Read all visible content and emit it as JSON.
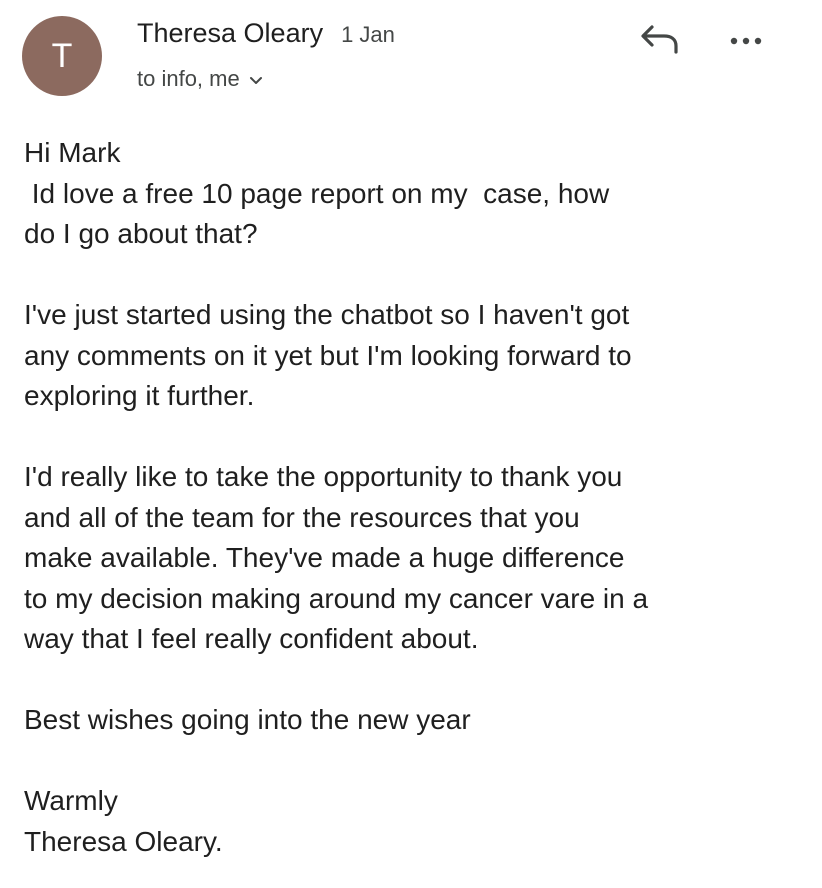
{
  "email": {
    "avatar_letter": "T",
    "avatar_color": "#8c6a5f",
    "sender_name": "Theresa Oleary",
    "date": "1 Jan",
    "recipients": "to info, me",
    "icons": {
      "reply": "reply-icon",
      "more": "more-options-icon",
      "expand": "chevron-down-icon"
    },
    "body": {
      "greeting": "Hi Mark",
      "line1": " Id love a free 10 page report on my  case, how",
      "line2": "do I go about that?",
      "line3": "I've just started using the chatbot so I haven't got",
      "line4": "any comments on it yet but I'm looking forward to",
      "line5": "exploring it further.",
      "line6": "I'd really like to take the opportunity to thank you",
      "line7": "and all of the team for the resources that you",
      "line8": "make available. They've made a huge difference",
      "line9": "to my decision making around my cancer vare in a",
      "line10": "way that I feel really confident about.",
      "wishes": "Best wishes going into the new year",
      "signoff": "Warmly",
      "signature": "Theresa Oleary."
    }
  }
}
